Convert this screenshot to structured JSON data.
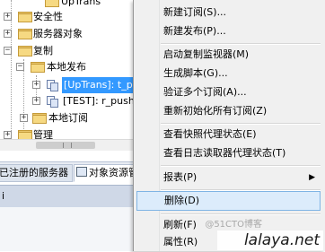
{
  "tree": {
    "top_partial": "UpTrans",
    "items": [
      {
        "label": "安全性"
      },
      {
        "label": "服务器对象"
      },
      {
        "label": "复制"
      },
      {
        "label": "本地发布"
      },
      {
        "label": "[UpTrans]: t_p"
      },
      {
        "label": "[TEST]: r_push"
      },
      {
        "label": "本地订阅"
      },
      {
        "label": "管理"
      }
    ]
  },
  "tabs": {
    "registered": "已注册的服务器",
    "explorer": "对象资源管"
  },
  "properties": {
    "header": "i"
  },
  "context_menu": {
    "items": [
      {
        "label": "新建订阅(S)..."
      },
      {
        "label": "新建发布(P)..."
      },
      {
        "label": "启动复制监视器(M)"
      },
      {
        "label": "生成脚本(G)..."
      },
      {
        "label": "验证多个订阅(A)..."
      },
      {
        "label": "重新初始化所有订阅(Z)"
      },
      {
        "label": "查看快照代理状态(E)"
      },
      {
        "label": "查看日志读取器代理状态(T)"
      },
      {
        "label": "报表(P)"
      },
      {
        "label": "删除(D)"
      },
      {
        "label": "刷新(F)"
      },
      {
        "label": "属性(R)"
      }
    ]
  },
  "watermark": {
    "ghost": "@51CTO博客",
    "logo": "lalaya.net"
  }
}
